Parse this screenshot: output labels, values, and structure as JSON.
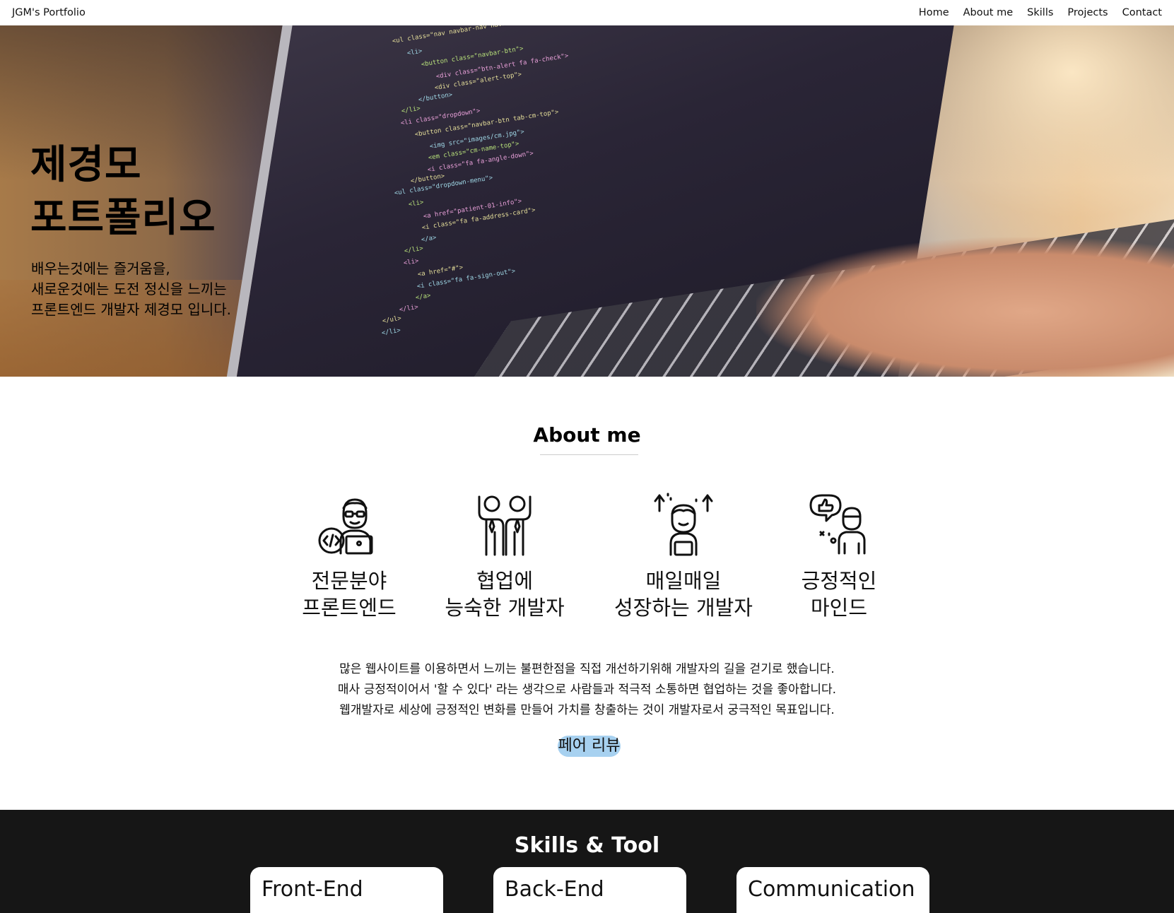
{
  "nav": {
    "brand": "JGM's Portfolio",
    "links": [
      "Home",
      "About me",
      "Skills",
      "Projects",
      "Contact"
    ]
  },
  "hero": {
    "title_line1": "제경모",
    "title_line2": "포트폴리오",
    "subtitle_lines": [
      "배우는것에는 즐거움을,",
      "새로운것에는 도전 정신을 느끼는",
      "프론트엔드 개발자 제경모 입니다."
    ],
    "code_lines": [
      "<ul class=\"nav navbar-nav navbar-right\">",
      "<li>",
      "<button class=\"navbar-btn\">",
      "<div class=\"btn-alert fa fa-check\">",
      "<div class=\"alert-top\">",
      "</button>",
      "</li>",
      "<li class=\"dropdown\">",
      "<button class=\"navbar-btn tab-cm-top\">",
      "<img src=\"images/cm.jpg\">",
      "<em class=\"cm-name-top\">",
      "<i class=\"fa fa-angle-down\">",
      "</button>",
      "<ul class=\"dropdown-menu\">",
      "<li>",
      "<a href=\"patient-01-info\">",
      "<i class=\"fa fa-address-card\">",
      "</a>",
      "</li>",
      "<li>",
      "<a href=\"#\">",
      "<i class=\"fa fa-sign-out\">",
      "</a>",
      "</li>",
      "</ul>",
      "</li>"
    ]
  },
  "about": {
    "title": "About me",
    "cards": [
      {
        "icon": "developer-laptop-icon",
        "label": "전문분야\n프론트엔드"
      },
      {
        "icon": "teamwork-icon",
        "label": "협업에\n능숙한 개발자"
      },
      {
        "icon": "growth-icon",
        "label": "매일매일\n성장하는 개발자"
      },
      {
        "icon": "positive-mind-icon",
        "label": "긍정적인\n마인드"
      }
    ],
    "description": [
      "많은 웹사이트를 이용하면서 느끼는 불편한점을 직접 개선하기위해 개발자의 길을 걷기로 했습니다.",
      "매사 긍정적이어서 '할 수 있다' 라는 생각으로 사람들과 적극적 소통하면 협업하는 것을 좋아합니다.",
      "웹개발자로 세상에 긍정적인 변화를 만들어 가치를 창출하는 것이 개발자로서 궁극적인 목표입니다."
    ],
    "peer_review_label": "페어 리뷰",
    "peer_review_color": "#a7d1f0"
  },
  "skills": {
    "title": "Skills & Tool",
    "cards": [
      "Front-End",
      "Back-End",
      "Communication"
    ],
    "background": "#161616"
  }
}
